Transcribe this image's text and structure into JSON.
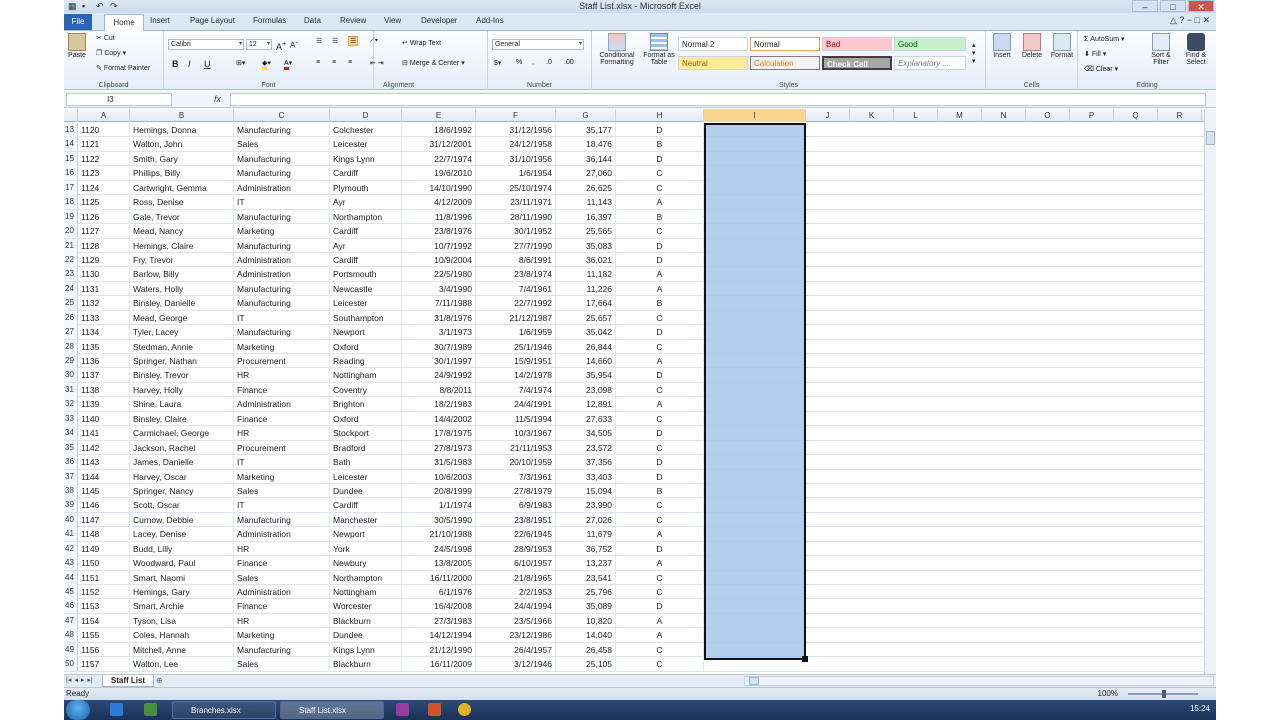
{
  "window": {
    "title": "Staff List.xlsx - Microsoft Excel"
  },
  "tabs": [
    "File",
    "Home",
    "Insert",
    "Page Layout",
    "Formulas",
    "Data",
    "Review",
    "View",
    "Developer",
    "Add-Ins"
  ],
  "ribbon": {
    "clipboard": {
      "label": "Clipboard",
      "paste": "Paste",
      "cut": "Cut",
      "copy": "Copy",
      "format_painter": "Format Painter"
    },
    "font": {
      "label": "Font",
      "name": "Calibri",
      "size": "12"
    },
    "alignment": {
      "label": "Alignment",
      "wrap": "Wrap Text",
      "merge": "Merge & Center"
    },
    "number": {
      "label": "Number",
      "format": "General"
    },
    "styles": {
      "label": "Styles",
      "conditional": "Conditional Formatting",
      "format_table": "Format as Table",
      "items": [
        {
          "name": "Normal 2",
          "bg": "#ffffff",
          "fg": "#222222"
        },
        {
          "name": "Normal",
          "bg": "#ffffff",
          "fg": "#222222"
        },
        {
          "name": "Bad",
          "bg": "#ffc7ce",
          "fg": "#9c0006"
        },
        {
          "name": "Good",
          "bg": "#c6efce",
          "fg": "#006100"
        },
        {
          "name": "Neutral",
          "bg": "#ffeb9c",
          "fg": "#9c6500"
        },
        {
          "name": "Calculation",
          "bg": "#f2f2f2",
          "fg": "#fa7d00"
        },
        {
          "name": "Check Cell",
          "bg": "#a5a5a5",
          "fg": "#ffffff"
        },
        {
          "name": "Explanatory ...",
          "bg": "#ffffff",
          "fg": "#7f7f7f"
        }
      ]
    },
    "cells": {
      "label": "Cells",
      "insert": "Insert",
      "delete": "Delete",
      "format": "Format"
    },
    "editing": {
      "label": "Editing",
      "autosum": "AutoSum",
      "fill": "Fill",
      "clear": "Clear",
      "sort": "Sort & Filter",
      "find": "Find & Select"
    }
  },
  "formula_bar": {
    "name_box": "I3",
    "fx": "fx",
    "value": ""
  },
  "columns": [
    "A",
    "B",
    "C",
    "D",
    "E",
    "F",
    "G",
    "H",
    "I",
    "J",
    "K",
    "L",
    "M",
    "N",
    "O",
    "P",
    "Q",
    "R"
  ],
  "rows": [
    [
      13,
      1120,
      "Hemings, Donna",
      "Manufacturing",
      "Colchester",
      "18/6/1992",
      "31/12/1956",
      "35,177",
      "D"
    ],
    [
      14,
      1121,
      "Walton, John",
      "Sales",
      "Leicester",
      "31/12/2001",
      "24/12/1958",
      "18,476",
      "B"
    ],
    [
      15,
      1122,
      "Smith, Gary",
      "Manufacturing",
      "Kings Lynn",
      "22/7/1974",
      "31/10/1956",
      "36,144",
      "D"
    ],
    [
      16,
      1123,
      "Phillips, Billy",
      "Manufacturing",
      "Cardiff",
      "19/6/2010",
      "1/6/1954",
      "27,060",
      "C"
    ],
    [
      17,
      1124,
      "Cartwright, Gemma",
      "Administration",
      "Plymouth",
      "14/10/1990",
      "25/10/1974",
      "26,625",
      "C"
    ],
    [
      18,
      1125,
      "Ross, Denise",
      "IT",
      "Ayr",
      "4/12/2009",
      "23/11/1971",
      "11,143",
      "A"
    ],
    [
      19,
      1126,
      "Gale, Trevor",
      "Manufacturing",
      "Northampton",
      "11/8/1996",
      "28/11/1990",
      "16,397",
      "B"
    ],
    [
      20,
      1127,
      "Mead, Nancy",
      "Marketing",
      "Cardiff",
      "23/8/1976",
      "30/1/1952",
      "25,565",
      "C"
    ],
    [
      21,
      1128,
      "Hemings, Claire",
      "Manufacturing",
      "Ayr",
      "10/7/1992",
      "27/7/1990",
      "35,083",
      "D"
    ],
    [
      22,
      1129,
      "Fry, Trevor",
      "Administration",
      "Cardiff",
      "10/9/2004",
      "8/6/1991",
      "36,021",
      "D"
    ],
    [
      23,
      1130,
      "Barlow, Billy",
      "Administration",
      "Portsmouth",
      "22/5/1980",
      "23/8/1974",
      "11,182",
      "A"
    ],
    [
      24,
      1131,
      "Waters, Holly",
      "Manufacturing",
      "Newcastle",
      "3/4/1990",
      "7/4/1961",
      "11,226",
      "A"
    ],
    [
      25,
      1132,
      "Binsley, Danielle",
      "Manufacturing",
      "Leicester",
      "7/11/1988",
      "22/7/1992",
      "17,664",
      "B"
    ],
    [
      26,
      1133,
      "Mead, George",
      "IT",
      "Southampton",
      "31/8/1976",
      "21/12/1987",
      "25,657",
      "C"
    ],
    [
      27,
      1134,
      "Tyler, Lacey",
      "Manufacturing",
      "Newport",
      "3/1/1973",
      "1/6/1959",
      "35,042",
      "D"
    ],
    [
      28,
      1135,
      "Stedman, Annie",
      "Marketing",
      "Oxford",
      "30/7/1989",
      "25/1/1946",
      "26,844",
      "C"
    ],
    [
      29,
      1136,
      "Springer, Nathan",
      "Procurement",
      "Reading",
      "30/1/1997",
      "15/9/1951",
      "14,660",
      "A"
    ],
    [
      30,
      1137,
      "Binsley, Trevor",
      "HR",
      "Nottingham",
      "24/9/1992",
      "14/2/1978",
      "35,954",
      "D"
    ],
    [
      31,
      1138,
      "Harvey, Holly",
      "Finance",
      "Coventry",
      "8/8/2011",
      "7/4/1974",
      "23,098",
      "C"
    ],
    [
      32,
      1139,
      "Shine, Laura",
      "Administration",
      "Brighton",
      "18/2/1983",
      "24/4/1991",
      "12,891",
      "A"
    ],
    [
      33,
      1140,
      "Binsley, Claire",
      "Finance",
      "Oxford",
      "14/4/2002",
      "11/5/1994",
      "27,633",
      "C"
    ],
    [
      34,
      1141,
      "Carmichael, George",
      "HR",
      "Stockport",
      "17/8/1975",
      "10/3/1967",
      "34,505",
      "D"
    ],
    [
      35,
      1142,
      "Jackson, Rachel",
      "Procurement",
      "Bradford",
      "27/8/1973",
      "21/11/1953",
      "23,572",
      "C"
    ],
    [
      36,
      1143,
      "James, Danielle",
      "IT",
      "Bath",
      "31/5/1983",
      "20/10/1959",
      "37,356",
      "D"
    ],
    [
      37,
      1144,
      "Harvey, Oscar",
      "Marketing",
      "Leicester",
      "10/6/2003",
      "7/3/1961",
      "33,403",
      "D"
    ],
    [
      38,
      1145,
      "Springer, Nancy",
      "Sales",
      "Dundee",
      "20/8/1999",
      "27/8/1979",
      "15,094",
      "B"
    ],
    [
      39,
      1146,
      "Scott, Oscar",
      "IT",
      "Cardiff",
      "1/1/1974",
      "6/9/1983",
      "23,990",
      "C"
    ],
    [
      40,
      1147,
      "Curnow, Debbie",
      "Manufacturing",
      "Manchester",
      "30/5/1990",
      "23/8/1951",
      "27,026",
      "C"
    ],
    [
      41,
      1148,
      "Lacey, Denise",
      "Administration",
      "Newport",
      "21/10/1988",
      "22/6/1945",
      "11,679",
      "A"
    ],
    [
      42,
      1149,
      "Budd, Lilly",
      "HR",
      "York",
      "24/5/1998",
      "28/9/1953",
      "36,752",
      "D"
    ],
    [
      43,
      1150,
      "Woodward, Paul",
      "Finance",
      "Newbury",
      "13/8/2005",
      "6/10/1957",
      "13,237",
      "A"
    ],
    [
      44,
      1151,
      "Smart, Naomi",
      "Sales",
      "Northampton",
      "16/11/2000",
      "21/8/1965",
      "23,541",
      "C"
    ],
    [
      45,
      1152,
      "Hemings, Gary",
      "Administration",
      "Nottingham",
      "6/1/1976",
      "2/2/1953",
      "25,796",
      "C"
    ],
    [
      46,
      1153,
      "Smart, Archie",
      "Finance",
      "Worcester",
      "16/4/2008",
      "24/4/1994",
      "35,089",
      "D"
    ],
    [
      47,
      1154,
      "Tyson, Lisa",
      "HR",
      "Blackburn",
      "27/3/1983",
      "23/5/1966",
      "10,820",
      "A"
    ],
    [
      48,
      1155,
      "Coles, Hannah",
      "Marketing",
      "Dundee",
      "14/12/1994",
      "23/12/1986",
      "14,040",
      "A"
    ],
    [
      49,
      1156,
      "Mitchell, Anne",
      "Manufacturing",
      "Kings Lynn",
      "21/12/1990",
      "26/4/1957",
      "26,458",
      "C"
    ],
    [
      50,
      1157,
      "Walton, Lee",
      "Sales",
      "Blackburn",
      "16/11/2009",
      "3/12/1946",
      "25,105",
      "C"
    ]
  ],
  "sheet_tab": "Staff List",
  "status": {
    "text": "Ready",
    "zoom": "100%"
  },
  "taskbar": {
    "items": [
      "Branches.xlsx",
      "Staff List.xlsx"
    ],
    "time": "15:24"
  }
}
